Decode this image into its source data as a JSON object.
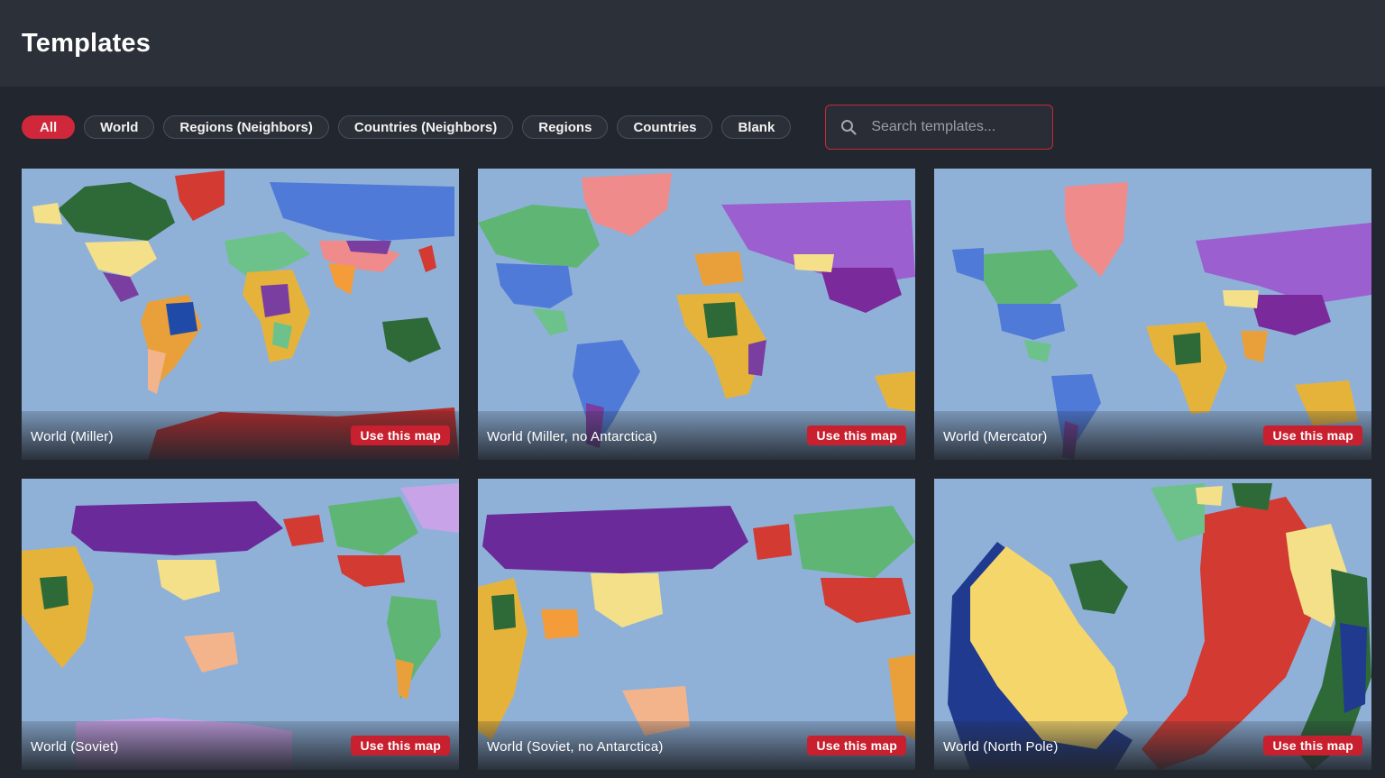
{
  "header": {
    "title": "Templates"
  },
  "filters": {
    "pills": [
      {
        "label": "All",
        "active": true
      },
      {
        "label": "World",
        "active": false
      },
      {
        "label": "Regions (Neighbors)",
        "active": false
      },
      {
        "label": "Countries (Neighbors)",
        "active": false
      },
      {
        "label": "Regions",
        "active": false
      },
      {
        "label": "Countries",
        "active": false
      },
      {
        "label": "Blank",
        "active": false
      }
    ],
    "search": {
      "placeholder": "Search templates...",
      "value": ""
    }
  },
  "cards": [
    {
      "title": "World (Miller)",
      "button": "Use this map"
    },
    {
      "title": "World (Miller, no Antarctica)",
      "button": "Use this map"
    },
    {
      "title": "World (Mercator)",
      "button": "Use this map"
    },
    {
      "title": "World (Soviet)",
      "button": "Use this map"
    },
    {
      "title": "World (Soviet, no Antarctica)",
      "button": "Use this map"
    },
    {
      "title": "World (North Pole)",
      "button": "Use this map"
    }
  ],
  "colors": {
    "accent": "#d0283a",
    "ocean": "#8fb1d8",
    "background": "#22262e",
    "header": "#2c3039"
  },
  "icons": {
    "search": "search-icon"
  }
}
